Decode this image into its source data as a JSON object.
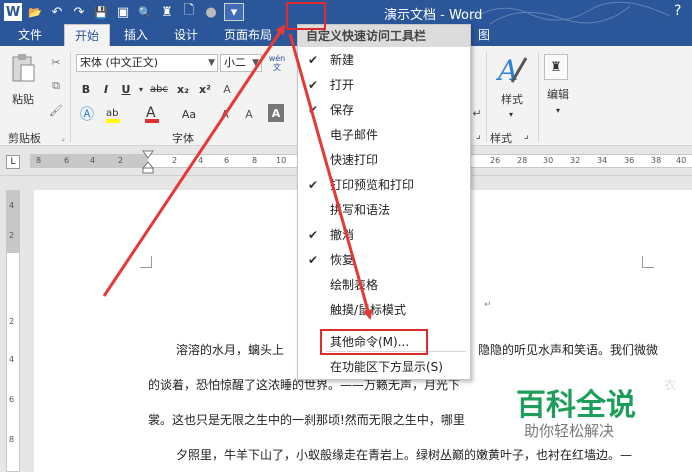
{
  "window": {
    "title": "演示文档 - Word",
    "help": "?",
    "qat": [
      {
        "name": "word-logo-icon",
        "glyph": "W"
      },
      {
        "name": "open-folder-icon",
        "glyph": "📂"
      },
      {
        "name": "undo-icon",
        "glyph": "↶"
      },
      {
        "name": "redo-icon",
        "glyph": "↷"
      },
      {
        "name": "save-icon",
        "glyph": "💾"
      },
      {
        "name": "save-as-icon",
        "glyph": "▣"
      },
      {
        "name": "print-preview-icon",
        "glyph": "🔍"
      },
      {
        "name": "find-icon",
        "glyph": "♜"
      },
      {
        "name": "new-doc-icon",
        "glyph": "🗋"
      },
      {
        "name": "circle-icon",
        "glyph": "●"
      },
      {
        "name": "customize-qat-icon",
        "glyph": "▾"
      }
    ]
  },
  "tabs": {
    "file": "文件",
    "home": "开始",
    "insert": "插入",
    "design": "设计",
    "layout": "页面布局",
    "partial": "图"
  },
  "ribbon": {
    "paste": "粘贴",
    "clipboard": "剪贴板",
    "font_name": "宋体 (中文正文)",
    "font_size": "小二",
    "font_group": "字体",
    "styles": "样式",
    "styles_group": "样式",
    "edit": "编辑",
    "bold": "B",
    "italic": "I",
    "underline": "U",
    "strike": "abc",
    "subscript": "x₂",
    "superscript": "x²",
    "aa": "Aa",
    "wen": "wén文"
  },
  "ruler": {
    "ticks_left": [
      "8",
      "6",
      "4",
      "2"
    ],
    "ticks_right": [
      "2",
      "4",
      "6",
      "8",
      "10"
    ],
    "ticks_far": [
      "26",
      "28",
      "30",
      "32",
      "34",
      "36",
      "38",
      "40"
    ],
    "corner": "L"
  },
  "vruler": [
    "4",
    "2",
    "2",
    "4",
    "6",
    "8"
  ],
  "menu": {
    "header": "自定义快速访问工具栏",
    "items": [
      {
        "label": "新建",
        "checked": true
      },
      {
        "label": "打开",
        "checked": true
      },
      {
        "label": "保存",
        "checked": true
      },
      {
        "label": "电子邮件",
        "checked": false
      },
      {
        "label": "快速打印",
        "checked": false
      },
      {
        "label": "打印预览和打印",
        "checked": true
      },
      {
        "label": "拼写和语法",
        "checked": false
      },
      {
        "label": "撤消",
        "checked": true
      },
      {
        "label": "恢复",
        "checked": true
      },
      {
        "label": "绘制表格",
        "checked": false
      },
      {
        "label": "触摸/鼠标模式",
        "checked": false
      }
    ],
    "more_commands": "其他命令(M)...",
    "show_below": "在功能区下方显示(S)",
    "check_glyph": "✔"
  },
  "document": {
    "lines": [
      "溶溶的水月，螭头上",
      "隐隐的听见水声和笑语。我们微微",
      "的谈着，恐怕惊醒了这浓睡的世界。——万籁无声，月光下",
      "衣",
      "裳。这也只是无限之生中的一刹那顷!然而无限之生中，哪里",
      "夕照里，牛羊下山了，小蚁般缘走在青岩上。绿树丛巅的嫩黄叶子，也衬在红墙边。—"
    ],
    "return_mark": "↵"
  },
  "watermark": {
    "big": "百科全说",
    "small": "助你轻松解决"
  }
}
